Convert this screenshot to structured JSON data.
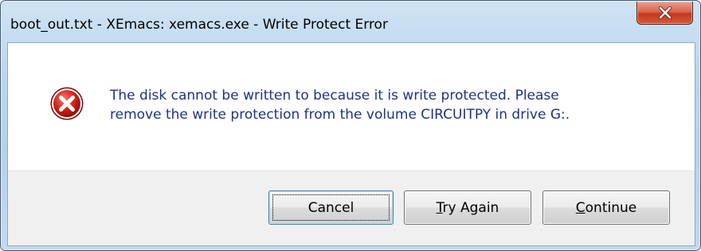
{
  "window": {
    "title": "boot_out.txt - XEmacs: xemacs.exe - Write Protect Error"
  },
  "dialog": {
    "icon": "error-icon",
    "message_line1": "The disk cannot be written to because it is write protected. Please",
    "message_line2": "remove the write protection from the volume CIRCUITPY in drive G:."
  },
  "buttons": {
    "cancel": "Cancel",
    "try_again_mnemonic": "T",
    "try_again_rest": "ry Again",
    "continue_mnemonic": "C",
    "continue_rest": "ontinue"
  },
  "colors": {
    "message_text": "#1e3287",
    "close_button": "#c4391d"
  }
}
